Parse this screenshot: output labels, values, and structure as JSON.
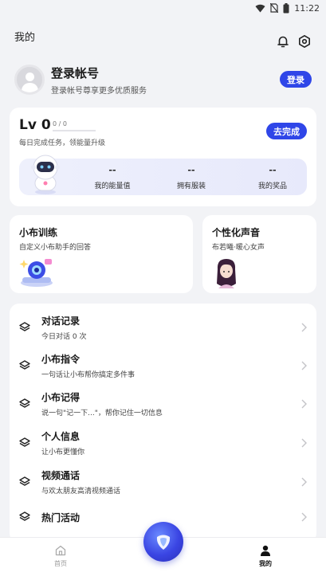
{
  "status_bar": {
    "time": "11:22"
  },
  "header": {
    "title": "我的"
  },
  "login": {
    "title": "登录帐号",
    "subtitle": "登录帐号尊享更多优质服务",
    "button": "登录"
  },
  "level": {
    "level_label": "Lv 0",
    "progress_text": "0 / 0",
    "progress": 0,
    "description": "每日完成任务，领能量升级",
    "button": "去完成",
    "stats": [
      {
        "value": "--",
        "label": "我的能量值"
      },
      {
        "value": "--",
        "label": "拥有服装"
      },
      {
        "value": "--",
        "label": "我的奖品"
      }
    ]
  },
  "cards": {
    "training": {
      "title": "小布训练",
      "subtitle": "自定义小布助手的回答"
    },
    "voice": {
      "title": "个性化声音",
      "subtitle": "布若曦·暖心女声"
    }
  },
  "menu": [
    {
      "title": "对话记录",
      "subtitle": "今日对话 0 次"
    },
    {
      "title": "小布指令",
      "subtitle": "一句话让小布帮你搞定多件事"
    },
    {
      "title": "小布记得",
      "subtitle": "说一句\"记一下...\"，帮你记住一切信息"
    },
    {
      "title": "个人信息",
      "subtitle": "让小布更懂你"
    },
    {
      "title": "视频通话",
      "subtitle": "与欢太朋友高清视频通话"
    },
    {
      "title": "热门活动",
      "subtitle": ""
    }
  ],
  "bottom_nav": {
    "home": "首页",
    "mine": "我的"
  },
  "colors": {
    "accent": "#2f46e8",
    "background": "#f2f3f6"
  }
}
